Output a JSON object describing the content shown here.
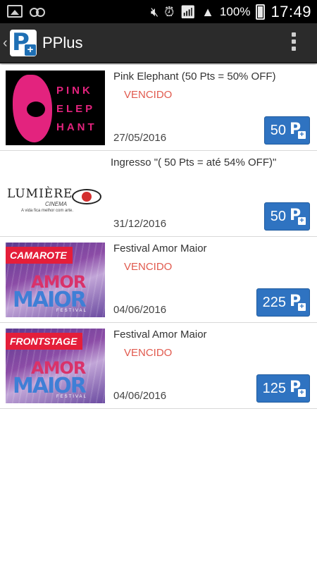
{
  "status_bar": {
    "battery_percent": "100%",
    "time": "17:49",
    "icons": [
      "image-icon",
      "voicemail-icon",
      "mute-icon",
      "alarm-icon",
      "wifi-icon",
      "signal-icon",
      "battery-icon"
    ]
  },
  "action_bar": {
    "title": "PPlus",
    "logo_letter": "P",
    "logo_plus": "+"
  },
  "items": [
    {
      "title": "Pink Elephant (50 Pts = 50% OFF)",
      "status": "VENCIDO",
      "date": "27/05/2016",
      "points": "50",
      "thumb_type": "pink-elephant",
      "thumb_text": [
        "PINK",
        "ELEP",
        "HANT"
      ]
    },
    {
      "title": "Ingresso  \"( 50 Pts = até 54% OFF)\"",
      "status": "",
      "date": "31/12/2016",
      "points": "50",
      "thumb_type": "lumiere",
      "thumb_text": [
        "LUMIÈRE",
        "CINEMA",
        "A vida fica melhor com arte."
      ]
    },
    {
      "title": "Festival Amor Maior",
      "status": "VENCIDO",
      "date": "04/06/2016",
      "points": "225",
      "thumb_type": "festival",
      "thumb_badge": "CAMAROTE",
      "thumb_text": [
        "AMOR",
        "MAIOR",
        "FESTIVAL"
      ]
    },
    {
      "title": "Festival Amor Maior",
      "status": "VENCIDO",
      "date": "04/06/2016",
      "points": "125",
      "thumb_type": "festival",
      "thumb_badge": "FRONTSTAGE",
      "thumb_text": [
        "AMOR",
        "MAIOR",
        "FESTIVAL"
      ]
    }
  ],
  "points_symbol": "P",
  "colors": {
    "status_expired": "#e15a4e",
    "button": "#2f73c1",
    "action_bar": "#2b2b2b"
  }
}
